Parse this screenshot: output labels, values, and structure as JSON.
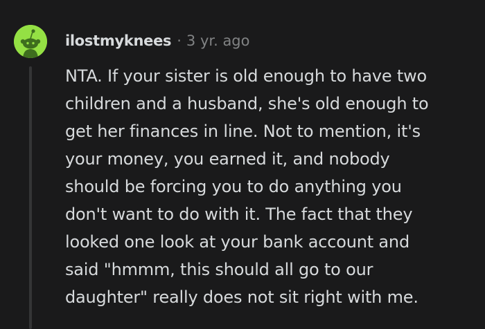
{
  "comment": {
    "author": "ilostmyknees",
    "separator": "·",
    "time": "3 yr. ago",
    "body_lines": [
      "NTA. If your sister is old enough to have two",
      "children and a husband, she's old enough to",
      "get her finances in line. Not to mention, it's",
      "your money, you earned it, and nobody",
      "should be forcing you to do anything you",
      "don't want to do with it. The fact that they",
      "looked one look at your bank account and",
      "said \"hmmm, this should all go to our",
      "daughter\" really does not sit right with me."
    ]
  },
  "colors": {
    "background": "#1a1a1b",
    "avatar_bg": "#94e044",
    "text": "#d7dadc",
    "muted": "#818384",
    "thread_line": "#343536"
  },
  "icons": {
    "avatar": "snoo-avatar-icon"
  }
}
